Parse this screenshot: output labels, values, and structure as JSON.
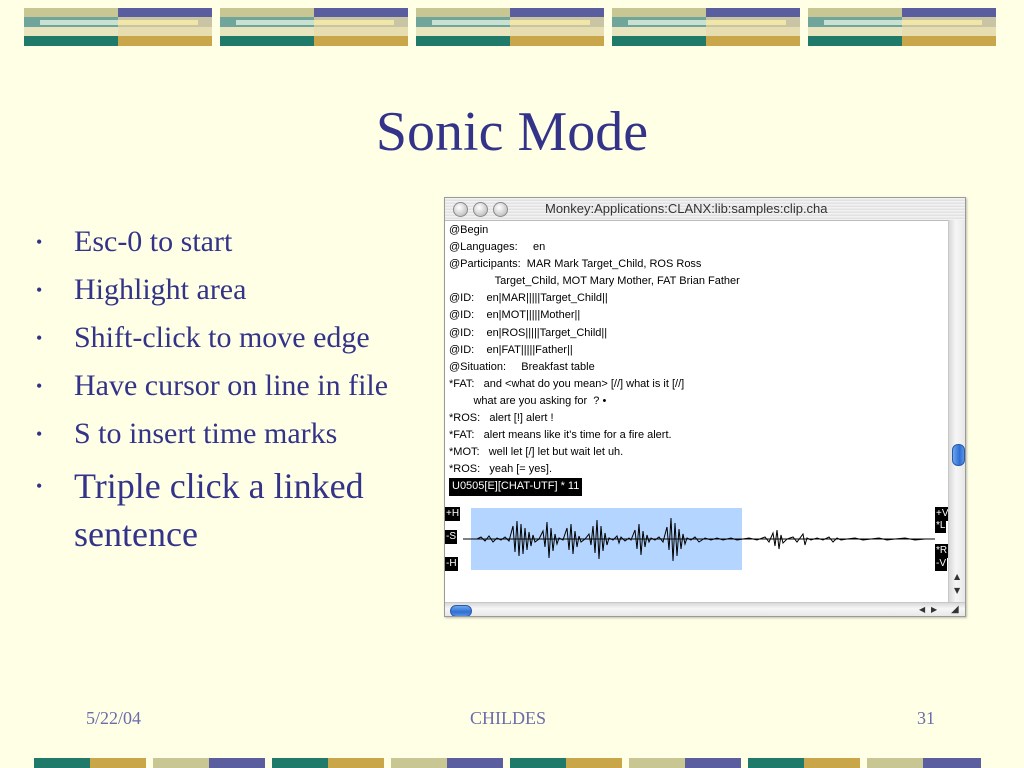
{
  "slide": {
    "title": "Sonic Mode",
    "bullets": [
      "Esc-0 to start",
      "Highlight area",
      "Shift-click to move edge",
      "Have cursor on line in file",
      "S to insert time marks",
      "Triple click a linked sentence"
    ],
    "footer": {
      "date": "5/22/04",
      "center": "CHILDES",
      "page": "31"
    }
  },
  "window": {
    "title": "Monkey:Applications:CLANX:lib:samples:clip.cha",
    "lines": [
      "@Begin",
      "@Languages:     en",
      "@Participants:  MAR Mark Target_Child, ROS Ross",
      "               Target_Child, MOT Mary Mother, FAT Brian Father",
      "@ID:    en|MAR|||||Target_Child||",
      "@ID:    en|MOT|||||Mother||",
      "@ID:    en|ROS|||||Target_Child||",
      "@ID:    en|FAT|||||Father||",
      "@Situation:     Breakfast table",
      "*FAT:   and <what do you mean> [//] what is it [//]",
      "        what are you asking for  ? •",
      "*ROS:   alert [!] alert !",
      "*FAT:   alert means like it's time for a fire alert.",
      "*MOT:   well let [/] let but wait let uh.",
      "*ROS:   yeah [= yes]."
    ],
    "status": "U0505[E][CHAT-UTF] * 11",
    "sonic_buttons_left": [
      "+H",
      "-S",
      "-H"
    ],
    "sonic_buttons_right": [
      "+V",
      "*L",
      "*R",
      "-V"
    ]
  },
  "colors": {
    "text": "#33338A",
    "selection": "#B4D5FF",
    "background": "#FFFFE5"
  }
}
